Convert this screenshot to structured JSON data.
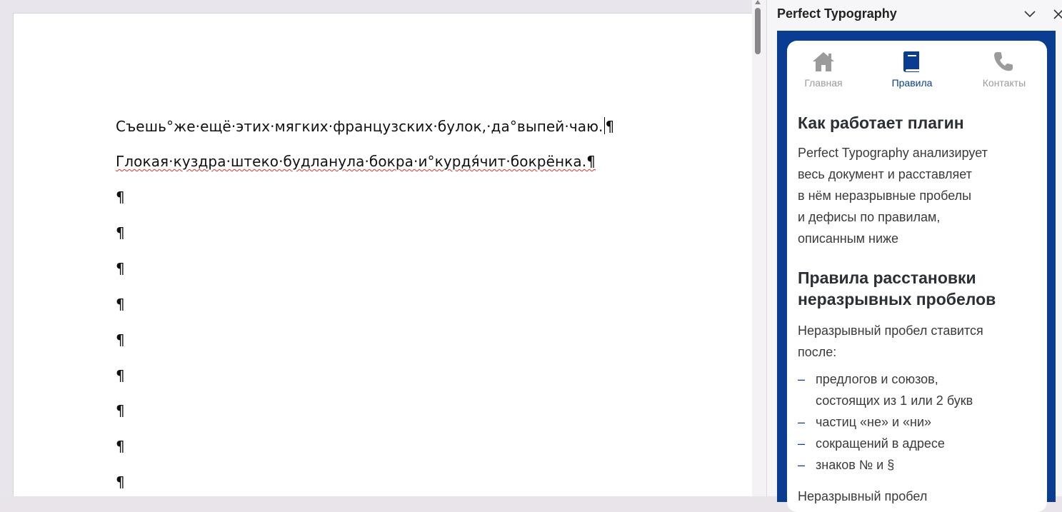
{
  "document": {
    "lines": [
      "Съешь°же·ещё·этих·мягких·французских·булок,·да°выпей·чаю.",
      "Глокая·куздра·штеко·будланула·бокра·и°курдя́чит·бокрёнка.¶",
      "¶",
      "¶",
      "¶",
      "¶",
      "¶",
      "¶",
      "¶",
      "¶",
      "¶"
    ],
    "line1_end": "¶"
  },
  "pane": {
    "title": "Perfect Typography",
    "tabs": [
      {
        "label": "Главная",
        "icon": "home-icon"
      },
      {
        "label": "Правила",
        "icon": "book-icon"
      },
      {
        "label": "Контакты",
        "icon": "phone-icon"
      }
    ],
    "active_tab": "Правила",
    "heading1": "Как работает плагин",
    "intro_lines": [
      "Perfect Typography анализирует",
      "весь документ и расставляет",
      "в нём неразрывные пробелы",
      "и дефисы по правилам,",
      "описанным ниже"
    ],
    "heading2_lines": [
      "Правила расстановки",
      "неразрывных пробелов"
    ],
    "rule_intro_lines": [
      "Неразрывный пробел ставится",
      "после:"
    ],
    "rules": [
      {
        "dash": "–",
        "line1": "предлогов и союзов,",
        "line2": "состоящих из 1 или 2 букв"
      },
      {
        "dash": "–",
        "line1": "частиц «не» и «ни»",
        "line2": ""
      },
      {
        "dash": "–",
        "line1": "сокращений в адресе",
        "line2": ""
      },
      {
        "dash": "–",
        "line1": "знаков № и §",
        "line2": ""
      }
    ],
    "cut_line": "Неразрывный пробел"
  },
  "colors": {
    "accent": "#0a3d91",
    "tab_inactive": "#9b9b9b",
    "spell_error": "#d9342b"
  }
}
